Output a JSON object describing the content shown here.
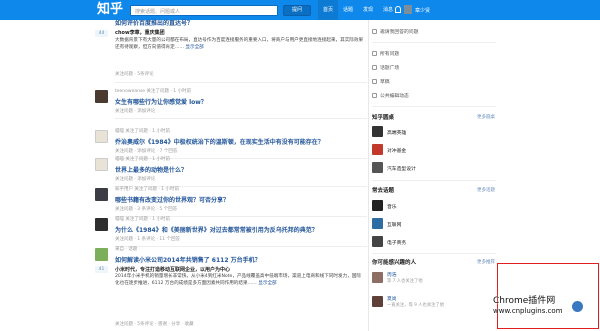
{
  "header": {
    "logo": "知乎",
    "search_placeholder": "搜索话题、问题或人",
    "ask_button": "提问",
    "nav": [
      "首页",
      "话题",
      "发现",
      "消息"
    ],
    "username": "章少贤"
  },
  "feed": [
    {
      "votes": "44",
      "question": "如何评价百度推出的直达号？",
      "author": "chow李章，重庆集团",
      "excerpt": "大数据背景下有大量的公司都在布局，直达号作为百度连接服务的重要入口，将商户与用户更直接地连接起来，其实际效果还有待观察，但方向值得肯定……",
      "more": "显示全部",
      "actions": "关注问题 · 5条评论"
    },
    {
      "meta": "teenoweanse 关注了问题 · 1 小时前",
      "question": "女生有哪些行为让你感觉爱 low？",
      "actions": "关注问题 · 添加评论"
    },
    {
      "meta": "喵喵 关注了问题 · 1 小时前",
      "question": "乔治奥威尔《1984》中极权统治下的温斯顿，在现实生活中有没有可能存在？",
      "actions": "关注问题 · 添加评论 · 7 个回答"
    },
    {
      "meta": "喵喵 关注了问题 · 1 小时前",
      "question": "世界上最多的动物是什么？",
      "actions": "关注问题 · 添加评论"
    },
    {
      "meta": "知乎用户 关注了问题 · 1 小时前",
      "question": "哪些书籍有改变过你的世界观？可否分享？",
      "actions": "关注问题 · 3 条评论 · 5 个回答"
    },
    {
      "meta": "喵喵 关注了问题 · 1 小时前",
      "question": "为什么《1984》和《美丽新世界》对过去都常常被引用为反乌托邦的典范？",
      "actions": "关注问题 · 1 条评论 · 11 个回答"
    },
    {
      "votes": "41",
      "meta": "来自 · 话题",
      "question": "如何解读小米公司2014年共销售了 6112 万台手机？",
      "author": "小米时代，专注打造移动互联网企业，以用户为中心",
      "excerpt": "2014年小米手机的销量增长非常快，从小米4到红米Note，产品线覆盖高中低端市场，渠道上电商和线下同时发力，国际化也在逐步推进，6112 万台的成绩是多方面因素共同作用的结果……",
      "more": "显示全部",
      "actions": "关注问题 · 5条评论 · 感谢 · 分享 · 收藏"
    }
  ],
  "sidebar": {
    "top_link": "邀请我回答的问题",
    "links": [
      "所有问题",
      "话题广场",
      "草稿",
      "公共编辑动态"
    ],
    "my_topics": {
      "title": "知乎圆桌",
      "more": "更多圆桌",
      "items": [
        "高端英雄",
        "对冲基金",
        "汽车造型设计"
      ]
    },
    "common_topics": {
      "title": "常去话题",
      "more": "更多话题",
      "items": [
        "音乐",
        "互联网",
        "电子商务"
      ]
    },
    "people": {
      "title": "你可能感兴趣的人",
      "more": "更多推荐",
      "items": [
        {
          "name": "周浩",
          "desc": "等 7 人也关注了他"
        },
        {
          "name": "夏尚",
          "desc": "一直关注，等 9 人也关注了他"
        }
      ]
    }
  },
  "watermark": {
    "main": "Chrome插件网",
    "url": "www.cnplugins.com"
  }
}
